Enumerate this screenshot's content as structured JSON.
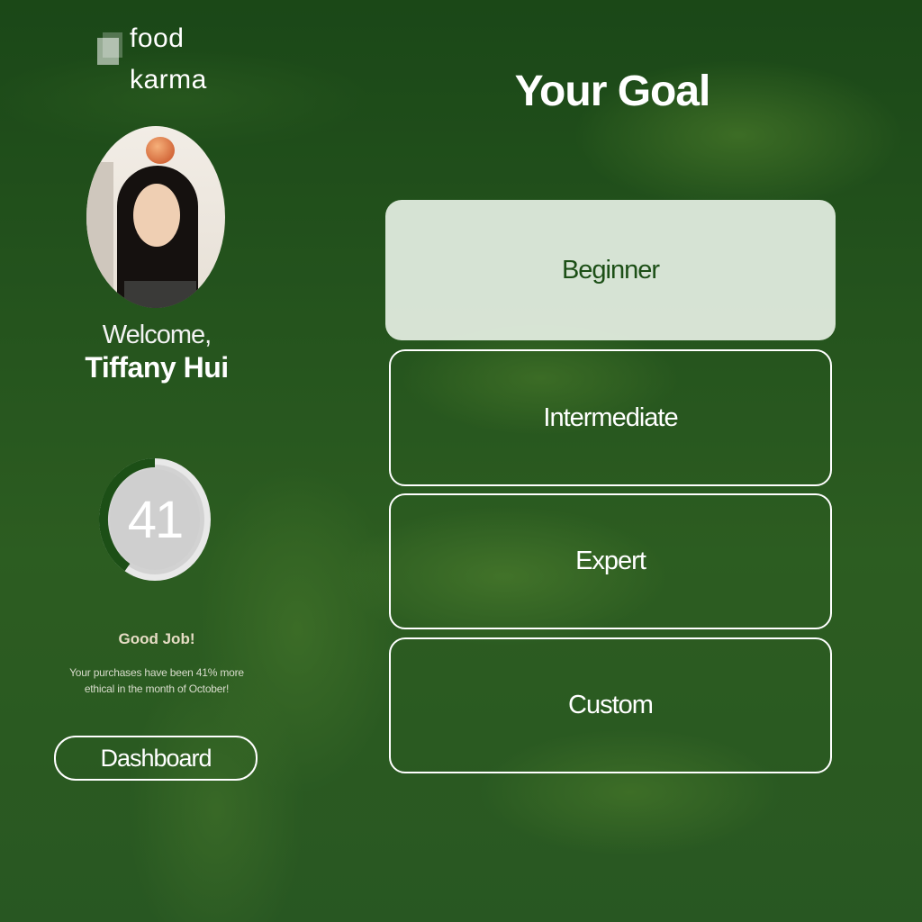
{
  "brand": {
    "line1": "food",
    "line2": "karma"
  },
  "user": {
    "welcome": "Welcome,",
    "name": "Tiffany Hui"
  },
  "score": {
    "value": "41",
    "progress_percent": 41,
    "ring_color": "#1c4f16",
    "track_color": "#d9d9d9"
  },
  "feedback": {
    "headline": "Good Job!",
    "message": "Your purchases have been 41% more ethical in the month of October!"
  },
  "nav": {
    "dashboard_label": "Dashboard"
  },
  "goal": {
    "title": "Your Goal",
    "options": [
      {
        "label": "Beginner",
        "selected": true
      },
      {
        "label": "Intermediate",
        "selected": false
      },
      {
        "label": "Expert",
        "selected": false
      },
      {
        "label": "Custom",
        "selected": false
      }
    ]
  },
  "icons": {
    "logo": "food-karma-logo-icon",
    "avatar": "user-avatar-photo"
  },
  "colors": {
    "accent_dark_green": "#1c4f16",
    "selected_bg": "#e6f0e4",
    "good_job_text": "#e6dcc4"
  }
}
